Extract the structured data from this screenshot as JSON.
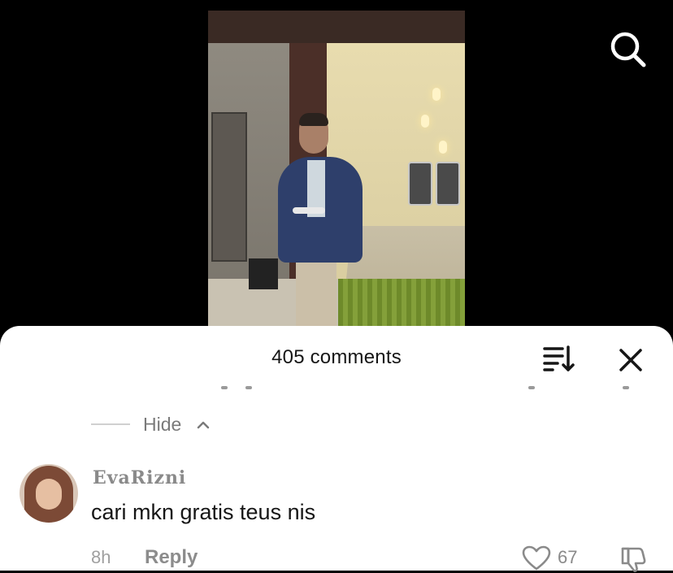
{
  "sheet": {
    "comments_count": "405 comments",
    "hide_label": "Hide"
  },
  "comment": {
    "username": "EvaRizni",
    "text": "cari mkn gratis teus nis",
    "time": "8h",
    "reply_label": "Reply",
    "like_count": "67"
  },
  "icons": {
    "search": "search-icon",
    "sort": "sort-icon",
    "close": "close-icon",
    "chevron": "chevron-up-icon",
    "like": "heart-icon",
    "dislike": "thumbs-down-icon"
  }
}
